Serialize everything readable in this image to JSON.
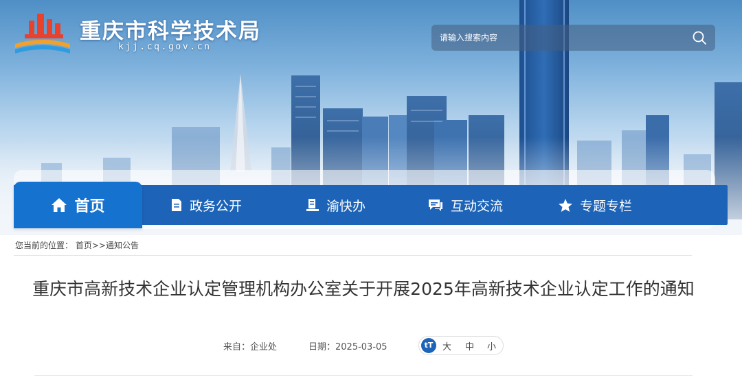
{
  "header": {
    "site_title": "重庆市科学技术局",
    "site_domain": "kjj.cq.gov.cn",
    "logo_icon": "chongqing-government-emblem-logo",
    "search": {
      "placeholder": "请输入搜索内容",
      "value": "",
      "icon": "search-icon"
    }
  },
  "nav": {
    "items": [
      {
        "label": "首页",
        "icon": "home-icon",
        "active": true
      },
      {
        "label": "政务公开",
        "icon": "document-icon"
      },
      {
        "label": "渝快办",
        "icon": "service-desk-icon"
      },
      {
        "label": "互动交流",
        "icon": "chat-bubble-icon"
      },
      {
        "label": "专题专栏",
        "icon": "star-icon"
      }
    ]
  },
  "breadcrumb": {
    "prefix": "您当前的位置：",
    "home": "首页",
    "separator": ">>",
    "current": "通知公告"
  },
  "article": {
    "title": "重庆市高新技术企业认定管理机构办公室关于开展2025年高新技术企业认定工作的通知",
    "from_label": "来自：",
    "from_value": "企业处",
    "date_label": "日期：",
    "date_value": "2025-03-05",
    "font_size": {
      "icon_text": "tT",
      "large": "大",
      "medium": "中",
      "small": "小"
    }
  },
  "colors": {
    "nav_blue": "#1d63b7",
    "nav_active": "#1672cf",
    "text": "#333333"
  }
}
